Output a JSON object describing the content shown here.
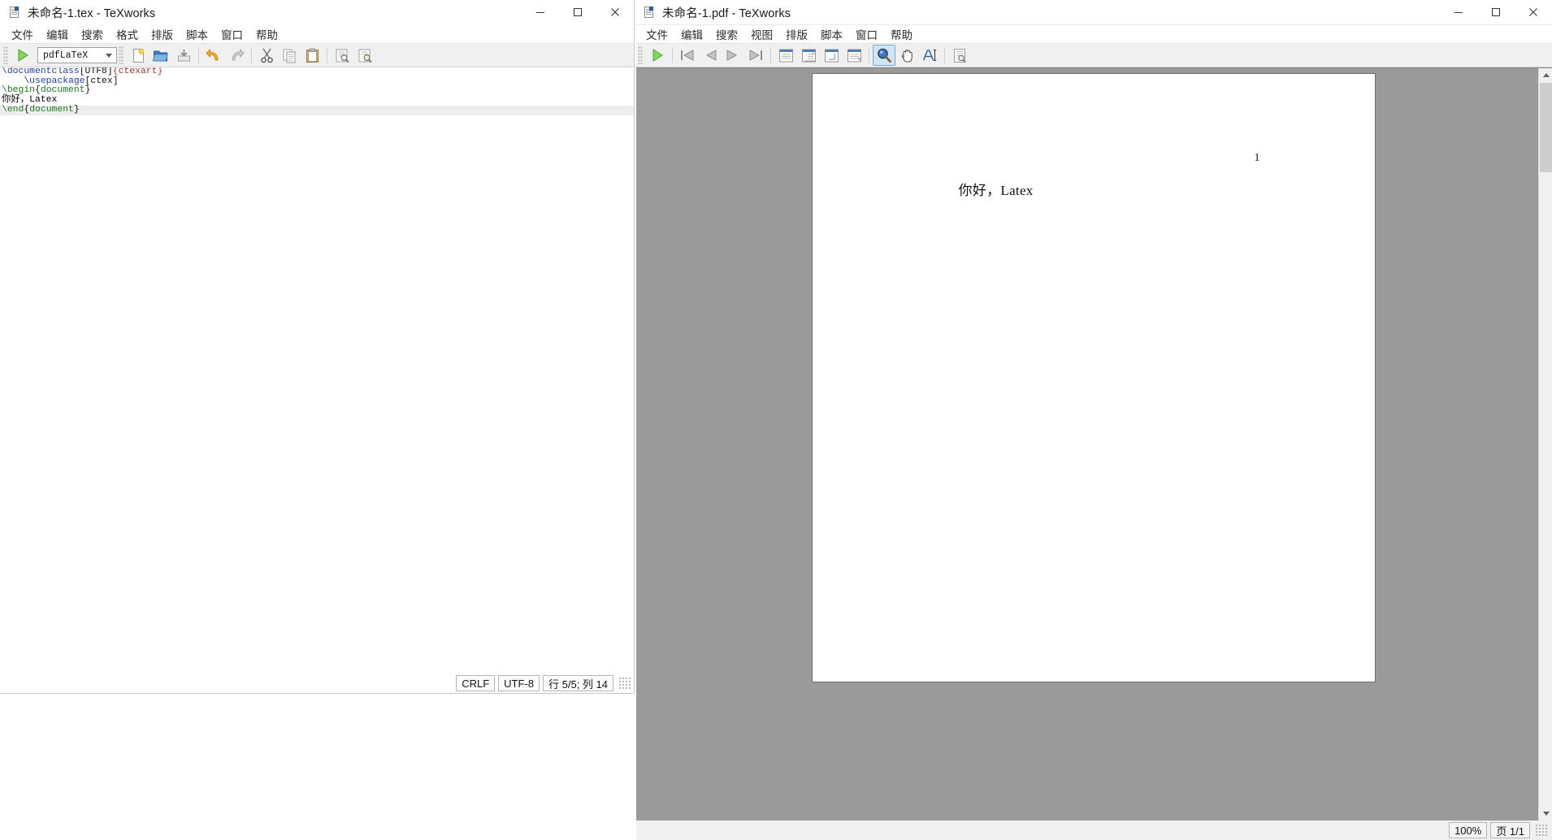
{
  "editor_window": {
    "title": "未命名-1.tex - TeXworks",
    "icon": "tex-document-icon",
    "title_buttons": {
      "minimize": "最小化",
      "maximize": "最大化",
      "close": "关闭"
    },
    "menus": [
      "文件",
      "编辑",
      "搜索",
      "格式",
      "排版",
      "脚本",
      "窗口",
      "帮助"
    ],
    "toolbar": {
      "typeset_button": "排版",
      "typeset_engine": "pdfLaTeX",
      "buttons": [
        {
          "name": "new-file-button",
          "label": "新建"
        },
        {
          "name": "open-file-button",
          "label": "打开"
        },
        {
          "name": "save-file-button",
          "label": "保存"
        },
        {
          "name": "undo-button",
          "label": "撤销"
        },
        {
          "name": "redo-button",
          "label": "重做"
        },
        {
          "name": "cut-button",
          "label": "剪切"
        },
        {
          "name": "copy-button",
          "label": "复制"
        },
        {
          "name": "paste-button",
          "label": "粘贴"
        },
        {
          "name": "find-button",
          "label": "查找"
        },
        {
          "name": "replace-button",
          "label": "替换"
        }
      ]
    },
    "code_lines": [
      {
        "indent": 0,
        "current": false,
        "tokens": [
          {
            "t": "\\documentclass",
            "c": "cs"
          },
          {
            "t": "[",
            "c": "brk"
          },
          {
            "t": "UTF8",
            "c": "opt"
          },
          {
            "t": "]",
            "c": "brk"
          },
          {
            "t": "{",
            "c": "arg"
          },
          {
            "t": "ctexart",
            "c": "arg"
          },
          {
            "t": "}",
            "c": "arg"
          }
        ]
      },
      {
        "indent": 4,
        "current": false,
        "tokens": [
          {
            "t": "\\usepackage",
            "c": "cs"
          },
          {
            "t": "[",
            "c": "brk"
          },
          {
            "t": "ctex",
            "c": "opt"
          },
          {
            "t": "]",
            "c": "brk"
          }
        ]
      },
      {
        "indent": 0,
        "current": false,
        "tokens": [
          {
            "t": "\\begin",
            "c": "env"
          },
          {
            "t": "{",
            "c": "brk"
          },
          {
            "t": "document",
            "c": "env"
          },
          {
            "t": "}",
            "c": "brk"
          }
        ]
      },
      {
        "indent": 0,
        "current": false,
        "tokens": [
          {
            "t": "你好，Latex",
            "c": "txt"
          }
        ]
      },
      {
        "indent": 0,
        "current": true,
        "tokens": [
          {
            "t": "\\end",
            "c": "env"
          },
          {
            "t": "{",
            "c": "brk"
          },
          {
            "t": "document",
            "c": "env"
          },
          {
            "t": "}",
            "c": "brk"
          }
        ]
      }
    ],
    "statusbar": {
      "line_ending": "CRLF",
      "encoding": "UTF-8",
      "position": "行 5/5; 列 14"
    }
  },
  "pdf_window": {
    "title": "未命名-1.pdf - TeXworks",
    "icon": "pdf-document-icon",
    "menus": [
      "文件",
      "编辑",
      "搜索",
      "视图",
      "排版",
      "脚本",
      "窗口",
      "帮助"
    ],
    "toolbar": {
      "buttons": [
        {
          "name": "typeset-button",
          "label": "排版"
        },
        {
          "name": "first-page-button",
          "label": "首页"
        },
        {
          "name": "previous-page-button",
          "label": "上一页"
        },
        {
          "name": "next-page-button",
          "label": "下一页"
        },
        {
          "name": "last-page-button",
          "label": "末页"
        },
        {
          "name": "fit-width-button",
          "label": "适合宽度"
        },
        {
          "name": "fit-window-button",
          "label": "适合窗口"
        },
        {
          "name": "actual-size-button",
          "label": "实际大小"
        },
        {
          "name": "fit-content-button",
          "label": "适合内容"
        },
        {
          "name": "magnify-tool-button",
          "label": "放大镜",
          "active": true
        },
        {
          "name": "pan-tool-button",
          "label": "手形工具"
        },
        {
          "name": "text-select-tool-button",
          "label": "选择文本"
        },
        {
          "name": "find-in-pdf-button",
          "label": "在PDF中查找"
        }
      ]
    },
    "page": {
      "page_number_label": "1",
      "body_text": "你好，Latex"
    },
    "statusbar": {
      "zoom": "100%",
      "page_indicator": "页 1/1"
    }
  },
  "colors": {
    "accent_blue": "#2a6099",
    "command_blue": "#1f3fa8",
    "env_green": "#1a7a1a",
    "arg_red": "#a33333",
    "pdf_bg_gray": "#9a9a9a",
    "toolbar_gray": "#f0f0f0",
    "active_highlight": "#cfe4f7"
  }
}
